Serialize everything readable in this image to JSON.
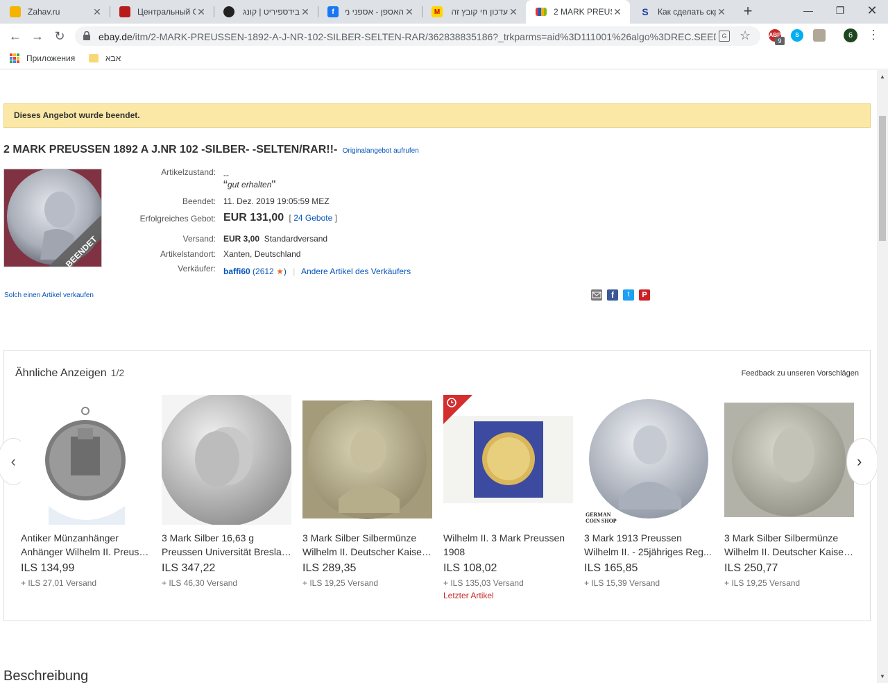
{
  "browser": {
    "tabs": [
      {
        "title": "Zahav.ru",
        "favicon_color": "#f4b400",
        "favicon_label": "",
        "active": false
      },
      {
        "title": "Центральный С",
        "favicon_color": "#b71c1c",
        "favicon_label": "",
        "active": false
      },
      {
        "title": "בידספיריט | קונג",
        "favicon_color": "#222222",
        "favicon_label": "",
        "active": false
      },
      {
        "title": "האספן - אספני מ",
        "favicon_color": "#1877f2",
        "favicon_label": "f",
        "active": false
      },
      {
        "title": "עדכון חי קובץ זה",
        "favicon_color": "#ffd600",
        "favicon_label": "M",
        "active": false
      },
      {
        "title": "2 MARK PREUSS",
        "favicon_color": "#0064d2",
        "favicon_label": "",
        "active": true
      },
      {
        "title": "Как сделать скр",
        "favicon_color": "#ffffff",
        "favicon_label": "S",
        "active": false
      }
    ],
    "url_host": "ebay.de",
    "url_path": "/itm/2-MARK-PREUSSEN-1892-A-J-NR-102-SILBER-SELTEN-RAR/362838835186?_trkparms=aid%3D111001%26algo%3DREC.SEED%2...",
    "extension_badge": "9",
    "profile_initial": "6",
    "bookmarks": [
      {
        "label": "Приложения",
        "icon": "apps-icon"
      },
      {
        "label": "אבא",
        "icon": "folder-icon"
      }
    ]
  },
  "listing": {
    "ended_notice": "Dieses Angebot wurde beendet.",
    "title": "2 MARK PREUSSEN 1892 A J.NR 102 -SILBER- -SELTEN/RAR!!-",
    "original_link": "Originalangebot aufrufen",
    "image_badge": "BEENDET",
    "condition_label": "Artikelzustand:",
    "condition_value": "--",
    "condition_note": "gut erhalten",
    "ended_label": "Beendet:",
    "ended_value": "11. Dez. 2019  19:05:59 MEZ",
    "price_label": "Erfolgreiches Gebot:",
    "price_value": "EUR 131,00",
    "bids_open": "[",
    "bids": "24 Gebote",
    "bids_close": "]",
    "shipping_label": "Versand:",
    "shipping_price": "EUR 3,00",
    "shipping_method": "Standardversand",
    "location_label": "Artikelstandort:",
    "location_value": "Xanten, Deutschland",
    "seller_label": "Verkäufer:",
    "seller_name": "baffi60",
    "seller_feedback_open": "(",
    "seller_feedback": "2612",
    "seller_feedback_close": ")",
    "seller_other": "Andere Artikel des Verkäufers",
    "sell_similar": "Solch einen Artikel verkaufen"
  },
  "similar": {
    "heading": "Ähnliche Anzeigen",
    "page": "1/2",
    "feedback": "Feedback zu unseren Vorschlägen",
    "items": [
      {
        "line1": "Antiker Münzanhänger",
        "line2": "Anhänger Wilhelm II. Preuss...",
        "price": "ILS 134,99",
        "shipping": "+ ILS 27,01 Versand",
        "note": ""
      },
      {
        "line1": "3 Mark Silber 16,63 g",
        "line2": "Preussen Universität Breslau...",
        "price": "ILS 347,22",
        "shipping": "+ ILS 46,30 Versand",
        "note": ""
      },
      {
        "line1": "3 Mark Silber Silbermünze",
        "line2": "Wilhelm II. Deutscher Kaiser...",
        "price": "ILS 289,35",
        "shipping": "+ ILS 19,25 Versand",
        "note": ""
      },
      {
        "line1": "Wilhelm II. 3 Mark Preussen",
        "line2": "1908",
        "price": "ILS 108,02",
        "shipping": "+ ILS 135,03 Versand",
        "note": "Letzter Artikel"
      },
      {
        "line1": "3 Mark 1913 Preussen",
        "line2": "Wilhelm II. - 25jähriges Reg...",
        "price": "ILS 165,85",
        "shipping": "+ ILS 15,39 Versand",
        "note": ""
      },
      {
        "line1": "3 Mark Silber Silbermünze",
        "line2": "Wilhelm II. Deutscher Kaiser...",
        "price": "ILS 250,77",
        "shipping": "+ ILS 19,25 Versand",
        "note": ""
      }
    ],
    "thumb_caption_5a": "GERMAN",
    "thumb_caption_5b": "COIN SHOP"
  },
  "description_heading": "Beschreibung"
}
